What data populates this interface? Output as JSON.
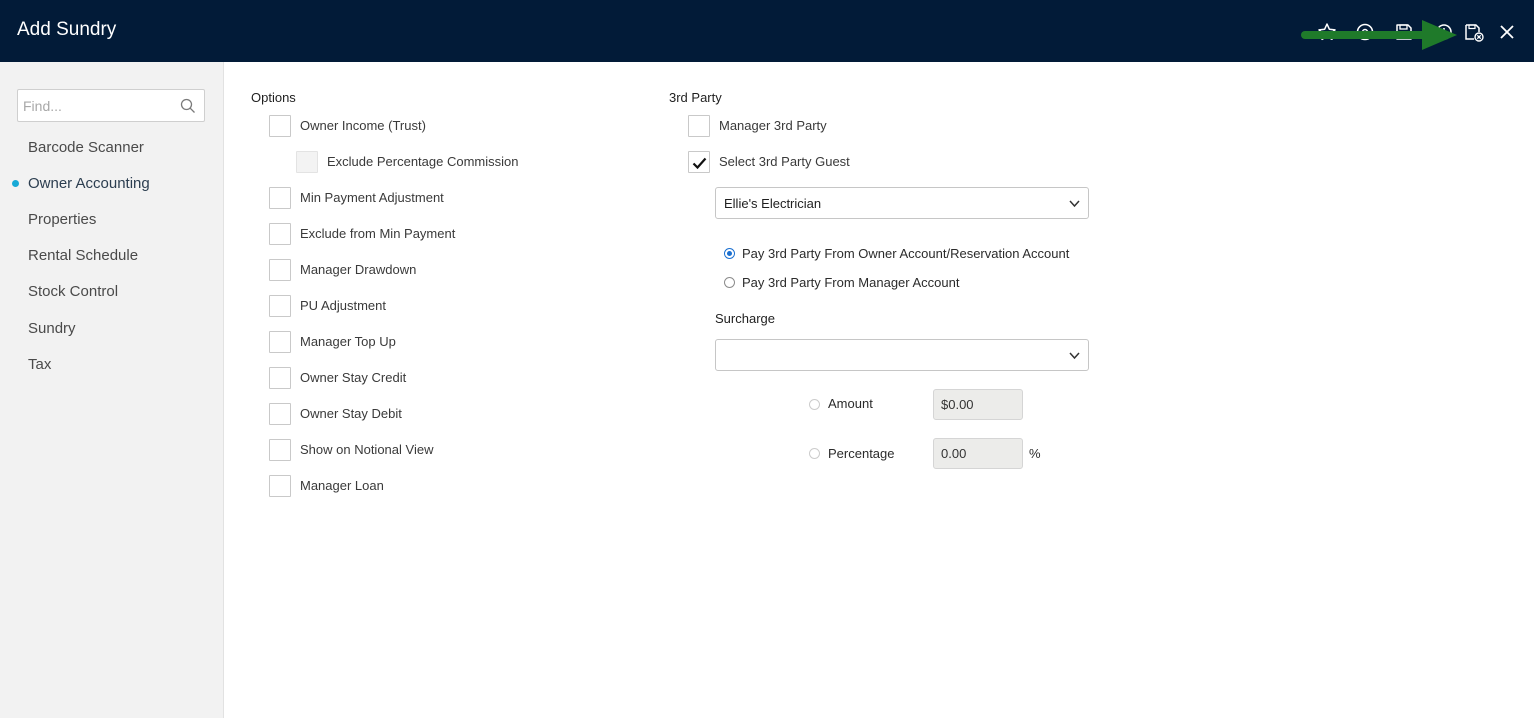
{
  "header": {
    "title": "Add Sundry",
    "icons": [
      "star-icon",
      "help-icon",
      "save-icon",
      "history-icon",
      "save-close-icon",
      "close-icon"
    ],
    "arrow_color": "#1f7a2a"
  },
  "sidebar": {
    "search_placeholder": "Find...",
    "items": [
      {
        "label": "Barcode Scanner"
      },
      {
        "label": "Owner Accounting",
        "active": true
      },
      {
        "label": "Properties"
      },
      {
        "label": "Rental Schedule"
      },
      {
        "label": "Stock Control"
      },
      {
        "label": "Sundry"
      },
      {
        "label": "Tax"
      }
    ],
    "active_color": "#17a9d6"
  },
  "options": {
    "title": "Options",
    "items": [
      {
        "label": "Owner Income (Trust)",
        "checked": false
      },
      {
        "label": "Exclude Percentage Commission",
        "checked": false,
        "disabled": true
      },
      {
        "label": "Min Payment Adjustment",
        "checked": false
      },
      {
        "label": "Exclude from Min Payment",
        "checked": false
      },
      {
        "label": "Manager Drawdown",
        "checked": false
      },
      {
        "label": "PU Adjustment",
        "checked": false
      },
      {
        "label": "Manager Top Up",
        "checked": false
      },
      {
        "label": "Owner Stay Credit",
        "checked": false
      },
      {
        "label": "Owner Stay Debit",
        "checked": false
      },
      {
        "label": "Show on Notional View",
        "checked": false
      },
      {
        "label": "Manager Loan",
        "checked": false
      }
    ]
  },
  "third_party": {
    "title": "3rd Party",
    "manager_label": "Manager 3rd Party",
    "manager_checked": false,
    "guest_label": "Select 3rd Party Guest",
    "guest_checked": true,
    "guest_select_value": "Ellie's Electrician",
    "pay_owner_label": "Pay 3rd Party From Owner Account/Reservation Account",
    "pay_owner_selected": true,
    "pay_manager_label": "Pay 3rd Party From Manager Account",
    "pay_manager_selected": false,
    "surcharge_label": "Surcharge",
    "surcharge_value": "",
    "amount_label": "Amount",
    "amount_value": "$0.00",
    "percentage_label": "Percentage",
    "percentage_value": "0.00",
    "percent_sign": "%"
  }
}
